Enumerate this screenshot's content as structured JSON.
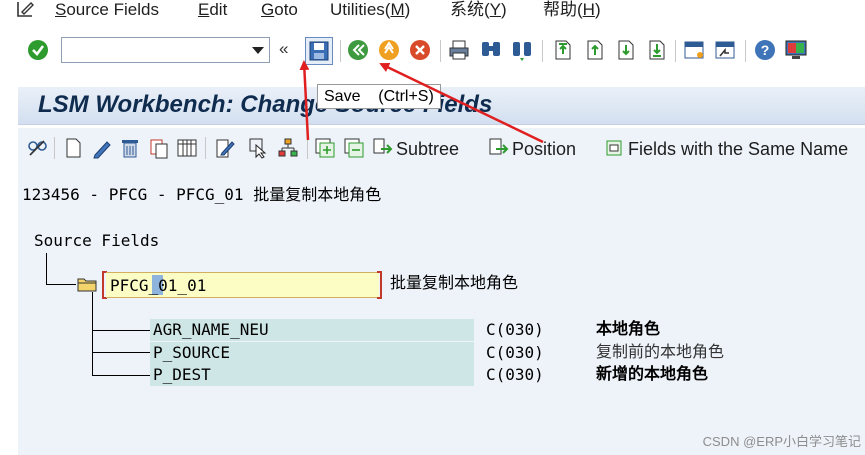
{
  "menu": {
    "items": [
      {
        "label": "Source Fields",
        "underline": "S",
        "rest": "ource Fields"
      },
      {
        "label": "Edit",
        "underline": "E",
        "rest": "dit"
      },
      {
        "label": "Goto",
        "underline": "G",
        "rest": "oto"
      },
      {
        "label": "Utilities(M)",
        "prefix": "Utilities(",
        "underline": "M",
        "suffix": ")"
      },
      {
        "label": "系统(Y)",
        "prefix": "系统(",
        "underline": "Y",
        "suffix": ")"
      },
      {
        "label": "帮助(H)",
        "prefix": "帮助(",
        "underline": "H",
        "suffix": ")"
      }
    ]
  },
  "toolbar": {
    "command_field_value": "",
    "collapse_label": "«",
    "save_icon": "save-icon"
  },
  "tooltip": {
    "text": "Save    (Ctrl+S)"
  },
  "title": {
    "text": "LSM Workbench: Change Source Fields"
  },
  "app_toolbar": {
    "subtree_label": "Subtree",
    "position_label": "Position",
    "same_name_label": "Fields with the Same Name"
  },
  "object": {
    "header_code": "123456 - PFCG - PFCG_01 ",
    "header_desc": "批量复制本地角色"
  },
  "tree": {
    "root_label": "Source Fields",
    "structure": {
      "name": "PFCG_01_01",
      "description": "批量复制本地角色"
    },
    "fields": [
      {
        "name": "AGR_NAME_NEU",
        "type": "C(030)",
        "description": "本地角色",
        "style": "bold"
      },
      {
        "name": "P_SOURCE",
        "type": "C(030)",
        "description": "复制前的本地角色",
        "style": "normal"
      },
      {
        "name": "P_DEST",
        "type": "C(030)",
        "description": "新增的本地角色",
        "style": "bold"
      }
    ]
  },
  "watermark": {
    "text": "CSDN @ERP小白学习笔记"
  },
  "colors": {
    "title_text": "#0f2c4f",
    "work_area": "#eef3fa",
    "field_bg": "#cfe6e6",
    "input_bg": "#fcfcc5",
    "annotation_arrow": "#e02020"
  }
}
